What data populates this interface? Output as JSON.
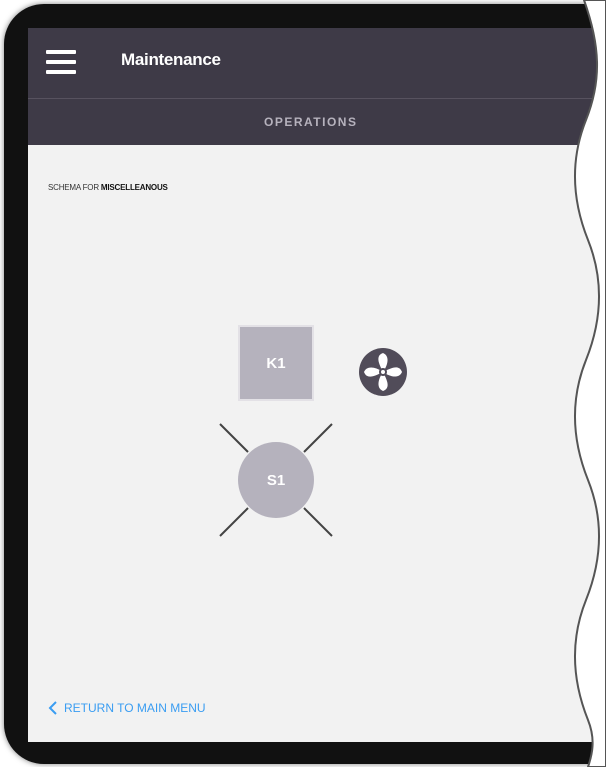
{
  "header": {
    "menu_icon": "hamburger-menu-icon",
    "title": "Maintenance"
  },
  "tabs": [
    {
      "label": "OPERATIONS",
      "active": true
    }
  ],
  "schema": {
    "prefix": "SCHEMA FOR ",
    "name": "MISCELLEANOUS"
  },
  "components": {
    "k1": {
      "label": "K1"
    },
    "fan": {
      "icon": "fan-icon"
    },
    "s1": {
      "label": "S1"
    }
  },
  "footer": {
    "return_icon": "chevron-left-icon",
    "return_label": "RETURN TO MAIN MENU"
  },
  "colors": {
    "topbar": "#3e3a47",
    "accent_link": "#3a9df2",
    "component_fill": "#b5b2bd"
  }
}
